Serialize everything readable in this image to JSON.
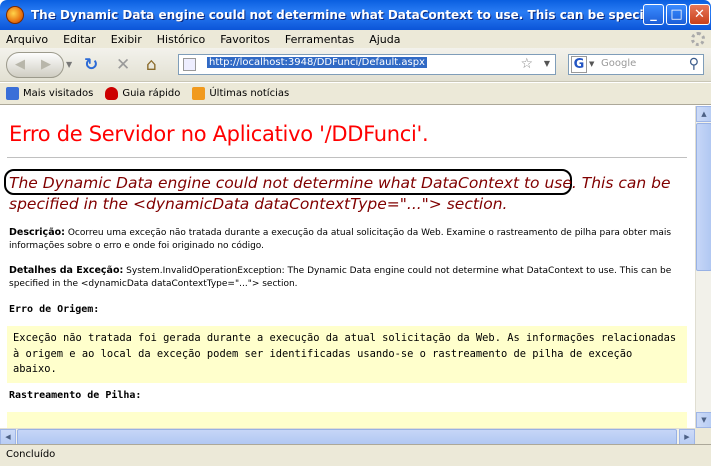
{
  "window": {
    "title": "The Dynamic Data engine could not determine what DataContext to use. This can be specified in the <dynami...",
    "minimize": "_",
    "maximize": "□",
    "close": "✕"
  },
  "menu": [
    "Arquivo",
    "Editar",
    "Exibir",
    "Histórico",
    "Favoritos",
    "Ferramentas",
    "Ajuda"
  ],
  "nav": {
    "url": "http://localhost:3948/DDFunci/Default.aspx",
    "search_placeholder": "Google",
    "search_engine": "G"
  },
  "bookmarks": [
    {
      "label": "Mais visitados",
      "icon": "bookmark-star-icon",
      "color": "#3a6fd8"
    },
    {
      "label": "Guia rápido",
      "icon": "redhat-icon",
      "color": "#cc0000"
    },
    {
      "label": "Últimas notícias",
      "icon": "rss-icon",
      "color": "#f19a1e"
    }
  ],
  "page": {
    "title": "Erro de Servidor no Aplicativo '/DDFunci'.",
    "error_message": "The Dynamic Data engine could not determine what DataContext to use. This can be specified in the <dynamicData dataContextType=\"...\"> section.",
    "description_label": "Descrição:",
    "description_text": "Ocorreu uma exceção não tratada durante a execução da atual solicitação da Web. Examine o rastreamento de pilha para obter mais informações sobre o erro e onde foi originado no código.",
    "exception_label": "Detalhes da Exceção:",
    "exception_text": "System.InvalidOperationException: The Dynamic Data engine could not determine what DataContext to use. This can be specified in the <dynamicData dataContextType=\"...\"> section.",
    "source_label": "Erro de Origem:",
    "source_text": "Exceção não tratada foi gerada durante a execução da atual solicitação da Web. As informações relacionadas à origem e ao local da exceção podem ser identificadas usando-se o rastreamento de pilha de exceção abaixo.",
    "stack_label": "Rastreamento de Pilha:"
  },
  "status": "Concluído",
  "colors": {
    "title_red": "#ff0000",
    "message_maroon": "#800000",
    "source_bg": "#ffffcc"
  }
}
